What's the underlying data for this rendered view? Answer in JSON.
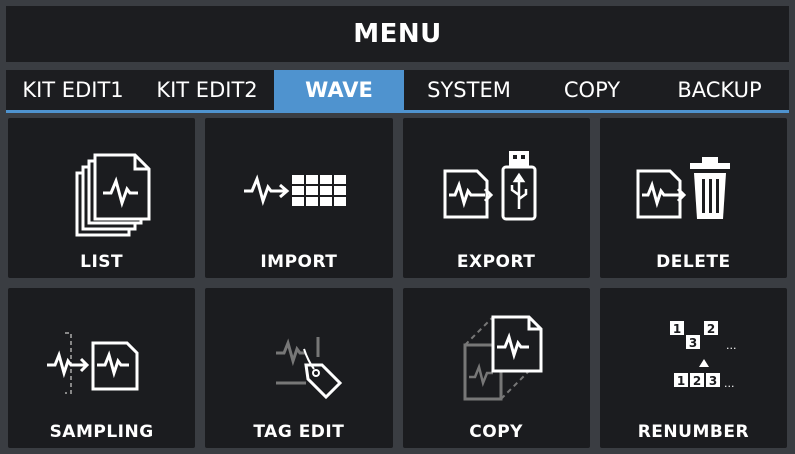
{
  "header": {
    "title": "MENU"
  },
  "tabs": [
    {
      "label": "KIT EDIT1"
    },
    {
      "label": "KIT EDIT2"
    },
    {
      "label": "WAVE"
    },
    {
      "label": "SYSTEM"
    },
    {
      "label": "COPY"
    },
    {
      "label": "BACKUP"
    }
  ],
  "active_tab": "WAVE",
  "tiles": [
    {
      "label": "LIST",
      "icon": "wave-list-icon"
    },
    {
      "label": "IMPORT",
      "icon": "wave-import-icon"
    },
    {
      "label": "EXPORT",
      "icon": "wave-export-usb-icon"
    },
    {
      "label": "DELETE",
      "icon": "wave-delete-trash-icon"
    },
    {
      "label": "SAMPLING",
      "icon": "wave-sampling-icon"
    },
    {
      "label": "TAG EDIT",
      "icon": "tag-edit-icon"
    },
    {
      "label": "COPY",
      "icon": "wave-copy-icon"
    },
    {
      "label": "RENUMBER",
      "icon": "renumber-icon",
      "digits": [
        "1",
        "2",
        "3",
        "..."
      ]
    }
  ],
  "colors": {
    "accent": "#4f93cf",
    "panel": "#1b1c1f",
    "background": "#3a3d42",
    "text": "#ffffff"
  }
}
